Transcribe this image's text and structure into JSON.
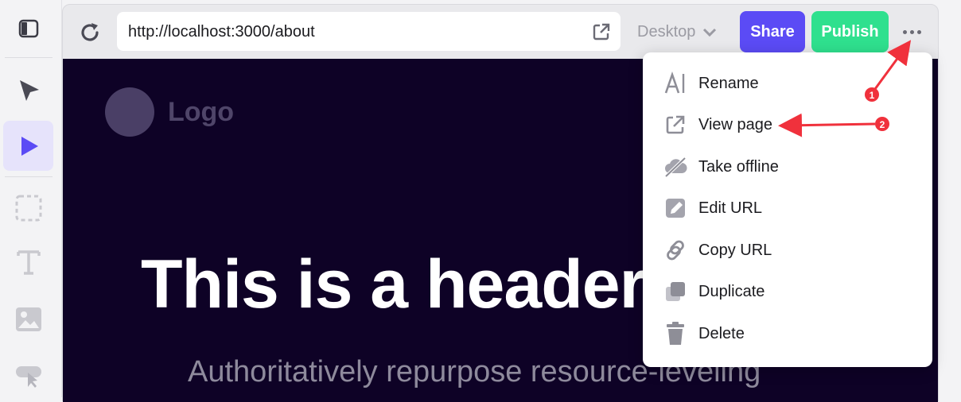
{
  "browser": {
    "url": "http://localhost:3000/about",
    "device": "Desktop",
    "share_label": "Share",
    "publish_label": "Publish"
  },
  "canvas": {
    "logo_text": "Logo",
    "hero_title_main": "This is a header ",
    "hero_title_accent": "a",
    "hero_subtitle": "Authoritatively repurpose resource-leveling"
  },
  "menu": {
    "items": [
      {
        "label": "Rename",
        "icon": "rename-icon"
      },
      {
        "label": "View page",
        "icon": "external-link-icon"
      },
      {
        "label": "Take offline",
        "icon": "offline-icon"
      },
      {
        "label": "Edit URL",
        "icon": "pencil-icon"
      },
      {
        "label": "Copy URL",
        "icon": "link-icon"
      },
      {
        "label": "Duplicate",
        "icon": "duplicate-icon"
      },
      {
        "label": "Delete",
        "icon": "trash-icon"
      }
    ]
  },
  "annotations": {
    "step1": "1",
    "step2": "2"
  },
  "colors": {
    "share": "#5b4bf5",
    "publish": "#2fe08e",
    "canvas_bg": "#0e0226",
    "accent": "#2fe0a8",
    "annotation": "#f0313c"
  }
}
